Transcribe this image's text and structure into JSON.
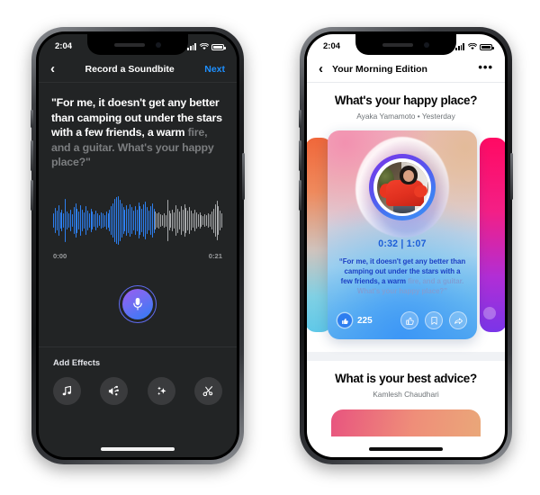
{
  "left_phone": {
    "status_bar": {
      "time": "2:04",
      "signal_icon": "cellular-bars-icon",
      "wifi_icon": "wifi-icon",
      "battery_icon": "battery-icon"
    },
    "navbar": {
      "back_icon": "chevron-left-icon",
      "title": "Record a Soundbite",
      "action_label": "Next"
    },
    "transcript": {
      "spoken": "\"For me, it doesn't get any better than camping out under the stars with a few friends, a warm ",
      "pending": "fire, and a guitar. What's your happy place?\""
    },
    "waveform": {
      "played_color": "#2d7ff0",
      "pending_color": "#a8aaac",
      "played_ratio": 0.6,
      "amplitudes": [
        0.3,
        0.52,
        0.4,
        0.62,
        0.34,
        0.46,
        0.28,
        0.9,
        0.38,
        0.3,
        0.44,
        0.26,
        0.56,
        0.72,
        0.5,
        0.38,
        0.64,
        0.46,
        0.34,
        0.58,
        0.42,
        0.3,
        0.48,
        0.36,
        0.26,
        0.4,
        0.3,
        0.22,
        0.34,
        0.28,
        0.24,
        0.36,
        0.3,
        0.44,
        0.58,
        0.72,
        0.88,
        0.96,
        1.0,
        0.84,
        0.7,
        0.56,
        0.44,
        0.62,
        0.5,
        0.66,
        0.54,
        0.42,
        0.58,
        0.46,
        0.74,
        0.6,
        0.48,
        0.66,
        0.78,
        0.54,
        0.42,
        0.6,
        0.72,
        0.5,
        0.36,
        0.28,
        0.34,
        0.26,
        0.22,
        0.3,
        0.24,
        0.86,
        0.4,
        0.3,
        0.46,
        0.34,
        0.62,
        0.5,
        0.38,
        0.58,
        0.44,
        0.66,
        0.52,
        0.4,
        0.56,
        0.42,
        0.3,
        0.44,
        0.34,
        0.26,
        0.32,
        0.24,
        0.2,
        0.26,
        0.22,
        0.3,
        0.26,
        0.38,
        0.5,
        0.66,
        0.82,
        0.58,
        0.4,
        0.28
      ],
      "start_time": "0:00",
      "end_time": "0:21"
    },
    "record_button": {
      "icon": "microphone-icon",
      "gradient_from": "#9b5cf0",
      "gradient_to": "#2f7cf6"
    },
    "effects": {
      "title": "Add Effects",
      "items": [
        {
          "icon": "music-note-icon"
        },
        {
          "icon": "sound-effects-icon"
        },
        {
          "icon": "sparkles-icon"
        },
        {
          "icon": "scissors-icon"
        }
      ]
    }
  },
  "right_phone": {
    "status_bar": {
      "time": "2:04",
      "signal_icon": "cellular-bars-icon",
      "wifi_icon": "wifi-icon",
      "battery_icon": "battery-icon"
    },
    "navbar": {
      "back_icon": "chevron-left-icon",
      "title": "Your Morning Edition",
      "more_icon": "more-options-icon"
    },
    "post": {
      "title": "What's your happy place?",
      "byline": "Ayaka Yamamoto • Yesterday",
      "card": {
        "time_display": "0:32 | 1:07",
        "quote_spoken": "“For me, it doesn't get any better than camping out under the stars with a few friends, a warm ",
        "quote_pending": "fire, and a guitar. What's your happy place?”",
        "like_count": "225",
        "like_badge_icon": "thumbs-up-filled-icon",
        "actions": [
          {
            "icon": "thumbs-up-icon"
          },
          {
            "icon": "bookmark-icon"
          },
          {
            "icon": "share-icon"
          }
        ],
        "avatar_icon": "user-avatar-photo"
      }
    },
    "next_post": {
      "title": "What is your best advice?",
      "byline": "Kamlesh Chaudhari"
    }
  }
}
